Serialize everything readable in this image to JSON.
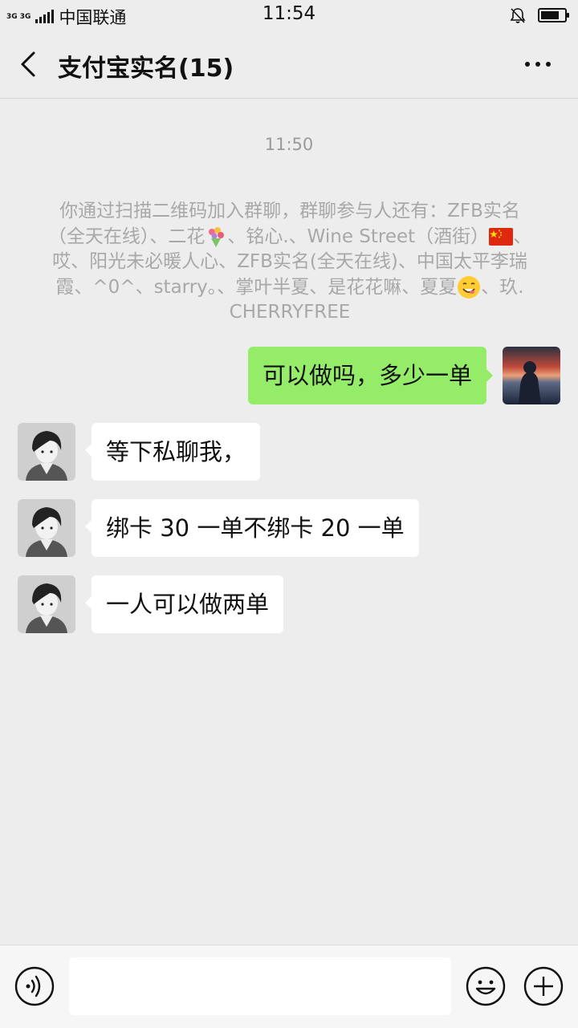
{
  "status_bar": {
    "network": "3G 3G",
    "carrier": "中国联通",
    "time": "11:54"
  },
  "header": {
    "title": "支付宝实名(15)"
  },
  "chat": {
    "timestamp": "11:50",
    "system_message_parts": [
      "你通过扫描二维码加入群聊，群聊参与人还有：ZFB实名（全天在线）、二花",
      "、铭心.、Wine Street（酒街）",
      "、哎、阳光未必暖人心、ZFB实名(全天在线)、中国太平李瑞霞、^0^、starry。、掌叶半夏、是花花嘛、夏夏",
      "、玖. CHERRYFREE"
    ],
    "messages": [
      {
        "side": "out",
        "text": "可以做吗，多少一单"
      },
      {
        "side": "in",
        "text": "等下私聊我，"
      },
      {
        "side": "in",
        "text": "绑卡 30 一单不绑卡 20 一单"
      },
      {
        "side": "in",
        "text": "一人可以做两单"
      }
    ]
  },
  "input_bar": {
    "placeholder": ""
  },
  "icons": {
    "back": "chevron-left-icon",
    "more": "more-dots-icon",
    "voice": "voice-icon",
    "emoji": "emoji-icon",
    "plus": "plus-icon",
    "mute": "bell-muted-icon",
    "battery": "battery-icon"
  },
  "colors": {
    "outgoing_bubble": "#95ec69",
    "incoming_bubble": "#ffffff",
    "background": "#ededed"
  }
}
